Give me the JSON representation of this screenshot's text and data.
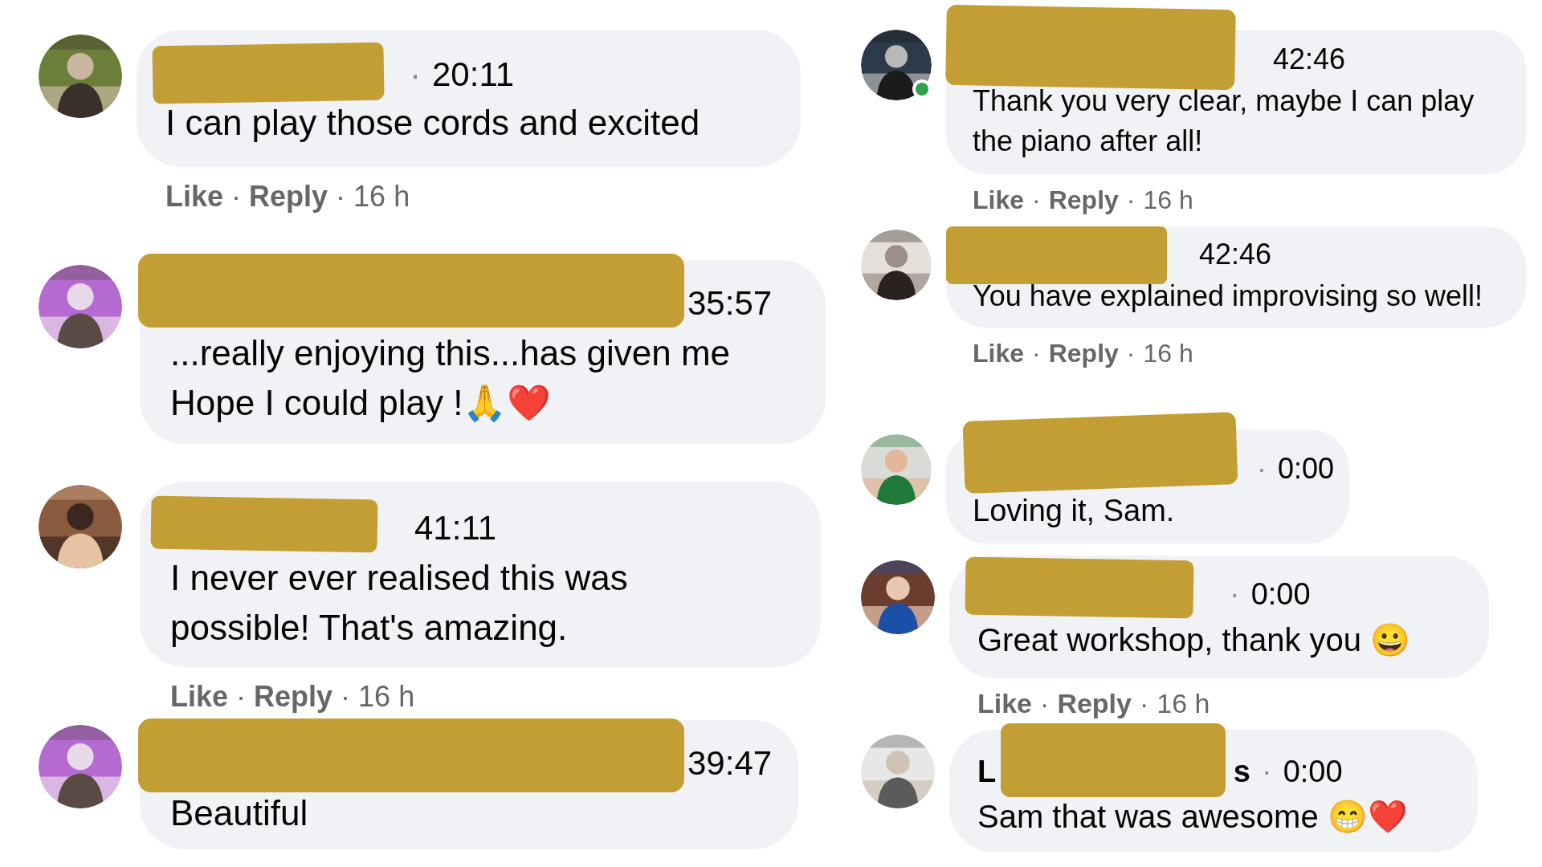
{
  "columns": [
    {
      "comments": [
        {
          "online": false,
          "separator": "·",
          "time": "20:11",
          "text": "I can play those cords and excited",
          "actions": {
            "like": "Like",
            "sep1": "·",
            "reply": "Reply",
            "sep2": "·",
            "age": "16 h"
          }
        },
        {
          "online": false,
          "time": "35:57",
          "text": "...really enjoying this...has given me Hope I could play !🙏❤️"
        },
        {
          "online": false,
          "time": "41:11",
          "text": "I never ever realised this was possible! That's amazing.",
          "actions": {
            "like": "Like",
            "sep1": "·",
            "reply": "Reply",
            "sep2": "·",
            "age": "16 h"
          }
        },
        {
          "online": false,
          "time": "39:47",
          "text": "Beautiful"
        }
      ]
    },
    {
      "comments": [
        {
          "online": true,
          "time": "42:46",
          "text": "Thank you very clear, maybe I can play the piano after all!",
          "actions": {
            "like": "Like",
            "sep1": "·",
            "reply": "Reply",
            "sep2": "·",
            "age": "16 h"
          }
        },
        {
          "online": false,
          "time": "42:46",
          "text": "You have explained improvising so well!",
          "actions": {
            "like": "Like",
            "sep1": "·",
            "reply": "Reply",
            "sep2": "·",
            "age": "16 h"
          }
        },
        {
          "online": false,
          "separator": "·",
          "time": "0:00",
          "text": "Loving it, Sam."
        },
        {
          "online": false,
          "separator": "·",
          "time": "0:00",
          "text": "Great workshop, thank you 😀",
          "actions": {
            "like": "Like",
            "sep1": "·",
            "reply": "Reply",
            "sep2": "·",
            "age": "16 h"
          }
        },
        {
          "online": false,
          "name_start": "L",
          "name_end": "s",
          "separator": "·",
          "time": "0:00",
          "text": "Sam that was awesome 😁❤️"
        }
      ]
    }
  ]
}
